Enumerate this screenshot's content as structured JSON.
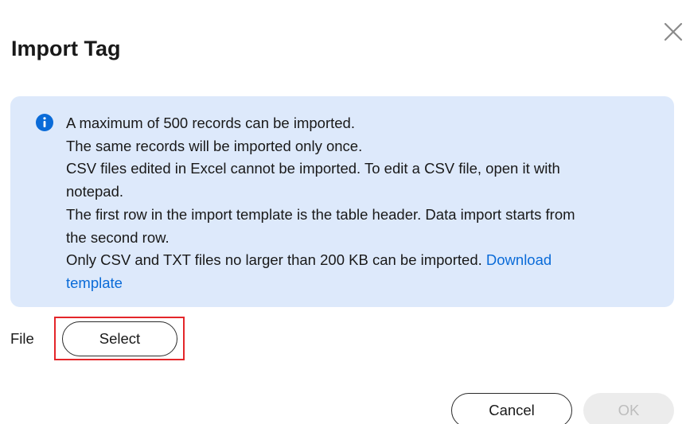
{
  "dialog": {
    "title": "Import Tag",
    "close_icon": "close-icon"
  },
  "info": {
    "icon": "info-icon",
    "accent_color": "#0a6bd8",
    "background_color": "#dde9fb",
    "lines": [
      "A maximum of 500 records can be imported.",
      "The same records will be imported only once.",
      "CSV files edited in Excel cannot be imported. To edit a CSV file, open it with",
      "notepad.",
      "The first row in the import template is the table header. Data import starts from",
      "the second row.",
      "Only CSV and TXT files no larger than 200 KB can be imported. "
    ],
    "download_link_line1": "Download",
    "download_link_line2": "template"
  },
  "file": {
    "label": "File",
    "select_label": "Select",
    "highlight_color": "#e4262a"
  },
  "footer": {
    "cancel_label": "Cancel",
    "ok_label": "OK",
    "ok_disabled": true
  }
}
